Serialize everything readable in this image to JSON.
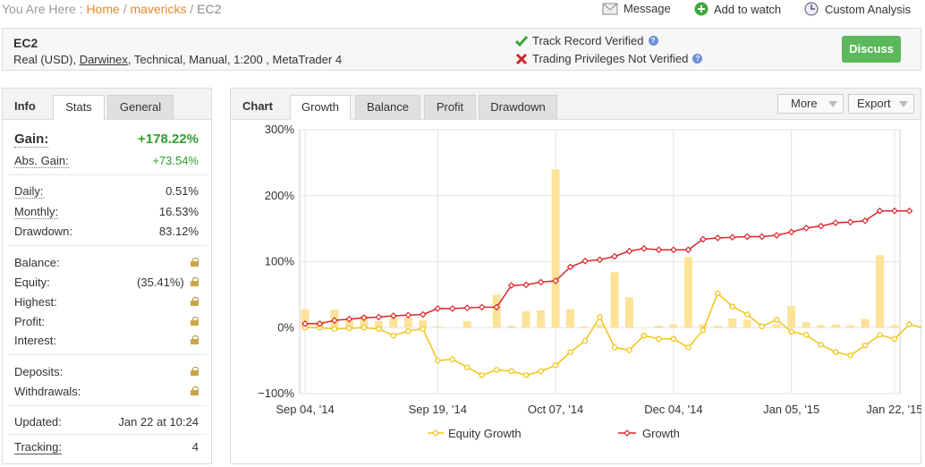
{
  "breadcrumb": {
    "prefix": "You Are Here :",
    "home": "Home",
    "sep": "/",
    "section": "mavericks",
    "current": "EC2"
  },
  "top_actions": {
    "message": "Message",
    "watch": "Add to watch",
    "analysis": "Custom Analysis"
  },
  "header": {
    "title": "EC2",
    "sub_pre": "Real (USD), ",
    "broker": "Darwinex",
    "sub_post": ", Technical, Manual, 1:200 , MetaTrader 4",
    "track_record": "Track Record Verified",
    "trading_privileges": "Trading Privileges Not Verified",
    "discuss": "Discuss"
  },
  "info_panel": {
    "title": "Info",
    "tabs": [
      "Stats",
      "General"
    ],
    "gain_label": "Gain:",
    "gain_value": "+178.22%",
    "abs_gain_label": "Abs. Gain:",
    "abs_gain_value": "+73.54%",
    "daily_label": "Daily:",
    "daily_value": "0.51%",
    "monthly_label": "Monthly:",
    "monthly_value": "16.53%",
    "drawdown_label": "Drawdown:",
    "drawdown_value": "83.12%",
    "balance_label": "Balance:",
    "equity_label": "Equity:",
    "equity_value": "(35.41%)",
    "highest_label": "Highest:",
    "profit_label": "Profit:",
    "interest_label": "Interest:",
    "deposits_label": "Deposits:",
    "withdrawals_label": "Withdrawals:",
    "updated_label": "Updated:",
    "updated_value": "Jan 22 at 10:24",
    "tracking_label": "Tracking:",
    "tracking_value": "4"
  },
  "chart_panel": {
    "title": "Chart",
    "tabs": [
      "Growth",
      "Balance",
      "Profit",
      "Drawdown"
    ],
    "more": "More",
    "export": "Export"
  },
  "colors": {
    "growth": "#d9262c",
    "equity": "#f0c419",
    "bars": "#fde397",
    "gain_green": "#2e9e2e",
    "discuss": "#5cb85c",
    "link_orange": "#e8892a"
  },
  "chart_data": {
    "type": "line",
    "ylim": [
      -100,
      300
    ],
    "yticks": [
      "300%",
      "200%",
      "100%",
      "0%",
      "−100%"
    ],
    "yticks_values": [
      300,
      200,
      100,
      0,
      -100
    ],
    "x_labels": [
      "Sep 04, '14",
      "Sep 19, '14",
      "Oct 07, '14",
      "Dec 04, '14",
      "Jan 05, '15",
      "Jan 22, '15"
    ],
    "x_label_index": [
      0,
      9,
      17,
      25,
      33,
      40
    ],
    "n_points": 41,
    "grid": true,
    "legend_position": "bottom",
    "series": [
      {
        "name": "Equity Growth",
        "values": [
          0,
          0,
          -2,
          -1,
          0,
          -2,
          -12,
          -5,
          -2,
          -50,
          -48,
          -60,
          -72,
          -64,
          -66,
          -72,
          -66,
          -57,
          -37,
          -20,
          16,
          -30,
          -34,
          -12,
          -17,
          -17,
          -30,
          -4,
          52,
          32,
          20,
          2,
          12,
          -6,
          -11,
          -26,
          -37,
          -42,
          -27,
          -11,
          -17,
          5,
          -1
        ]
      },
      {
        "name": "Growth",
        "values": [
          6,
          6,
          11,
          13,
          15,
          16,
          18,
          19,
          20,
          29,
          29,
          30,
          31,
          31,
          64,
          65,
          69,
          71,
          92,
          101,
          103,
          108,
          116,
          120,
          118,
          118,
          118,
          134,
          136,
          137,
          138,
          138,
          140,
          145,
          151,
          154,
          159,
          160,
          162,
          177,
          177,
          177
        ]
      },
      {
        "name": "bars",
        "values": [
          28,
          10,
          27,
          14,
          19,
          10,
          16,
          15,
          11,
          2,
          0,
          10,
          0,
          50,
          3,
          25,
          26,
          240,
          28,
          2,
          5,
          84,
          46,
          0,
          3,
          5,
          107,
          5,
          3,
          14,
          12,
          0,
          5,
          33,
          8,
          4,
          5,
          4,
          13,
          110,
          4
        ]
      }
    ]
  }
}
